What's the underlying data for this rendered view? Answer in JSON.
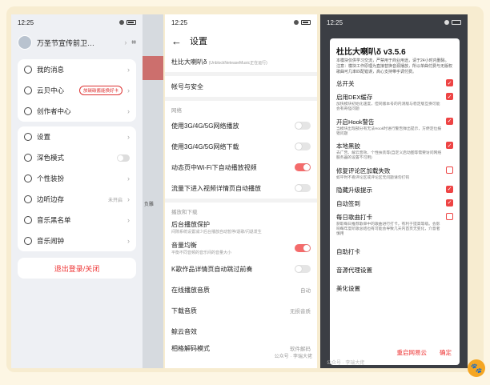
{
  "screen1": {
    "time": "12:25",
    "username": "万圣节宣传前卫…",
    "card1": [
      {
        "label": "我的消息"
      },
      {
        "label": "云贝中心",
        "tag": "放碳碳酱能换好卡"
      },
      {
        "label": "创作者中心"
      }
    ],
    "card2": [
      {
        "label": "设置"
      },
      {
        "label": "深色模式"
      },
      {
        "label": "个性装扮"
      },
      {
        "label": "边听边存",
        "sub": "未开启"
      },
      {
        "label": "音乐黑名单"
      },
      {
        "label": "音乐闹钟"
      }
    ],
    "logout": "退出登录/关闭",
    "side_label": "负雕"
  },
  "screen2": {
    "time": "12:25",
    "title": "设置",
    "app_item": "杜比大喇叭δ",
    "app_item_sub": "(UnblockNeteaseMusic正在运行)",
    "account": "帐号与安全",
    "section_network": "网络",
    "network": [
      {
        "label": "使用3G/4G/5G网络播放",
        "on": false
      },
      {
        "label": "使用3G/4G/5G网络下载",
        "on": false
      },
      {
        "label": "动态页中Wi-Fi下自动播放视频",
        "on": true
      },
      {
        "label": "流量下进入视频详情页自动播放",
        "on": false
      }
    ],
    "section_play": "播放和下载",
    "play_protect": "后台播放保护",
    "play_protect_sub": "间隙系统设置减少后台播放自动暂停/退歌/闪退发生",
    "equalizer": "音量均衡",
    "equalizer_sub": "平衡不同音频的音乐间的音量大小",
    "ktv": "K歌作品详情页自动跳过前奏",
    "online_quality": "在线播放音质",
    "online_quality_value": "自动",
    "download_quality": "下载音质",
    "download_quality_value": "无损音质",
    "cloud_effect": "鲸云音效",
    "partial_label": "相格解码模式",
    "partial_value": "软件解码",
    "watermark": "公众号 · 李瑞大佬"
  },
  "screen3": {
    "time": "12:25",
    "title": "杜比大喇叭δ v3.5.6",
    "desc": "本模块仅供学习交流，严禁用于商业用途，请于24小时内删除。\n注意：模块工作原理为直接替换音源播放，所以单曲付费与无版权歌曲可几率匹配错误，高心支持带手调付费。",
    "options": [
      {
        "title": "总开关",
        "desc": "",
        "checked": true
      },
      {
        "title": "启用DEX缓存",
        "desc": "加快模块初始化速度，但同版本号的内测版与稳定版互换可能会有奇怪问题",
        "checked": true
      },
      {
        "title": "开启Hook警告",
        "desc": "当模块出现部分有无法Hook时进行警告弹出提示，方便定位报错问题",
        "checked": true
      },
      {
        "title": "本地黑胶",
        "desc": "去广告、解云音效、个性扶装等(自定义启动图等需要访问网络服务器的设置不可用)",
        "checked": true
      },
      {
        "title": "修复评论区加载失败",
        "desc": "如平时不看评论区或评论区无问题请勿打钩",
        "checked": false
      },
      {
        "title": "隐藏升级提示",
        "desc": "",
        "checked": true
      },
      {
        "title": "自动签到",
        "desc": "",
        "checked": true
      },
      {
        "title": "每日歌曲打卡",
        "desc": "获取每日推荐歌单中的歌曲进行打卡，有利于提高等级。会影响每年度听歌总结也有可能会导致几天内首页无变化，介意者慎用",
        "checked": false
      }
    ],
    "plain": [
      "自助打卡",
      "音源代理设置",
      "美化设置"
    ],
    "btn_restart": "重启网易云",
    "btn_ok": "确定",
    "watermark": "公众号 · 李瑞大佬"
  }
}
